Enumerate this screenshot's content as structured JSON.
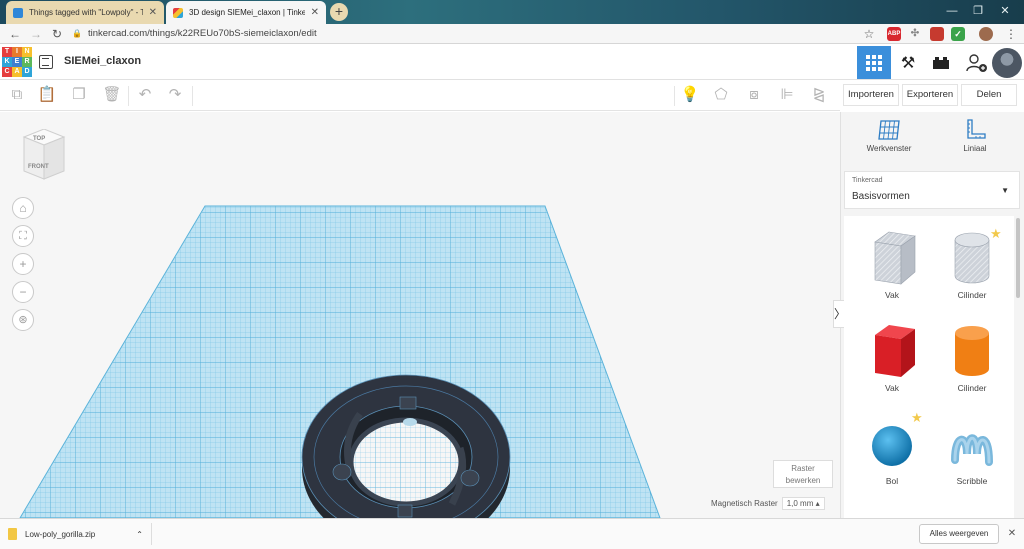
{
  "browser": {
    "tabs": [
      {
        "title": "Things tagged with \"Lowpoly\" - T",
        "favicon_color": "#2f87d8",
        "active": false
      },
      {
        "title": "3D design SIEMei_claxon | Tinker",
        "favicon_color": "#e25b3a",
        "active": true
      }
    ],
    "new_tab_label": "+",
    "url": "tinkercad.com/things/k22REUo70bS-siemeiclaxon/edit",
    "extensions": [
      {
        "name": "abp-icon",
        "label": "ABP",
        "color": "#d8282f"
      },
      {
        "name": "puzzle-icon",
        "label": "",
        "color": "#8a8a8a"
      },
      {
        "name": "pdf-icon",
        "label": "",
        "color": "#c63a2f"
      },
      {
        "name": "check-icon",
        "label": "✓",
        "color": "#3aa34a"
      },
      {
        "name": "profile-icon",
        "label": "",
        "color": "#9d6b4e"
      }
    ]
  },
  "app": {
    "logo_letters": [
      "T",
      "I",
      "N",
      "K",
      "E",
      "R",
      "C",
      "A",
      "D"
    ],
    "logo_colors": [
      "#e53e3e",
      "#e87a2c",
      "#f6c02d",
      "#2fa5d8",
      "#3f7fd0",
      "#5cb85c",
      "#e53e3e",
      "#f6c02d",
      "#2fa5d8"
    ],
    "design_title": "SIEMei_claxon"
  },
  "toolbar": {
    "import_label": "Importeren",
    "export_label": "Exporteren",
    "share_label": "Delen"
  },
  "viewcube": {
    "top_label": "TOP",
    "front_label": "FRONT"
  },
  "workplane": {
    "edit_grid_label_1": "Raster",
    "edit_grid_label_2": "bewerken",
    "snap_grid_label": "Magnetisch Raster",
    "snap_grid_value": "1,0 mm",
    "grid_color": "#8fd0ec",
    "model_color": "#2e3440"
  },
  "panel": {
    "workplane_tool_label": "Werkvenster",
    "ruler_tool_label": "Liniaal",
    "library_source": "Tinkercad",
    "library_name": "Basisvormen",
    "shapes": [
      {
        "label": "Vak",
        "color": "#c9ced6",
        "kind": "box",
        "starred": false
      },
      {
        "label": "Cilinder",
        "color": "#c9ced6",
        "kind": "cylinder",
        "starred": true
      },
      {
        "label": "Vak",
        "color": "#d91f26",
        "kind": "box",
        "starred": false
      },
      {
        "label": "Cilinder",
        "color": "#f07f14",
        "kind": "cylinder",
        "starred": false
      },
      {
        "label": "Bol",
        "color": "#1695d4",
        "kind": "sphere",
        "starred": true
      },
      {
        "label": "Scribble",
        "color": "#7ab8dc",
        "kind": "scribble",
        "starred": false
      }
    ]
  },
  "downloads": {
    "file_name": "Low-poly_gorilla.zip",
    "show_all_label": "Alles weergeven"
  }
}
